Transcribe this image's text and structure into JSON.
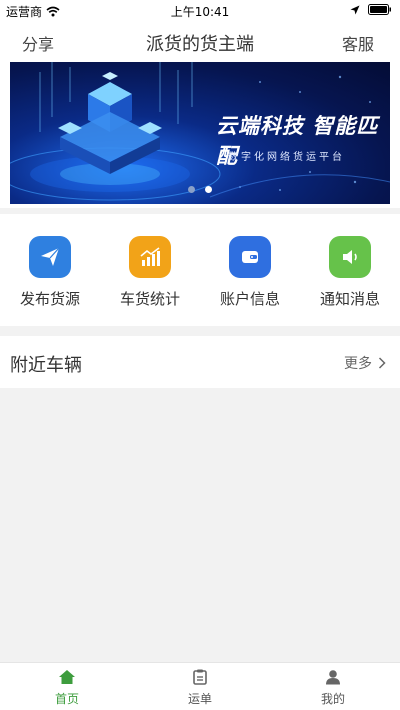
{
  "status_bar": {
    "carrier": "运营商",
    "time": "上午10:41"
  },
  "nav": {
    "left": "分享",
    "title": "派货的货主端",
    "right": "客服"
  },
  "banner": {
    "headline": "云端科技 智能匹配",
    "subline": "数字化网络货运平台"
  },
  "menu": [
    {
      "label": "发布货源",
      "icon": "send-icon",
      "color": "#2f80e0"
    },
    {
      "label": "车货统计",
      "icon": "chart-icon",
      "color": "#f2a318"
    },
    {
      "label": "账户信息",
      "icon": "wallet-icon",
      "color": "#2f6fe0"
    },
    {
      "label": "通知消息",
      "icon": "speaker-icon",
      "color": "#66c24a"
    }
  ],
  "nearby": {
    "title": "附近车辆",
    "more": "更多"
  },
  "tabbar": [
    {
      "label": "首页",
      "icon": "home-icon",
      "active": true
    },
    {
      "label": "运单",
      "icon": "clipboard-icon",
      "active": false
    },
    {
      "label": "我的",
      "icon": "user-icon",
      "active": false
    }
  ],
  "colors": {
    "accent": "#3e9d3e",
    "background": "#f2f2f2"
  }
}
